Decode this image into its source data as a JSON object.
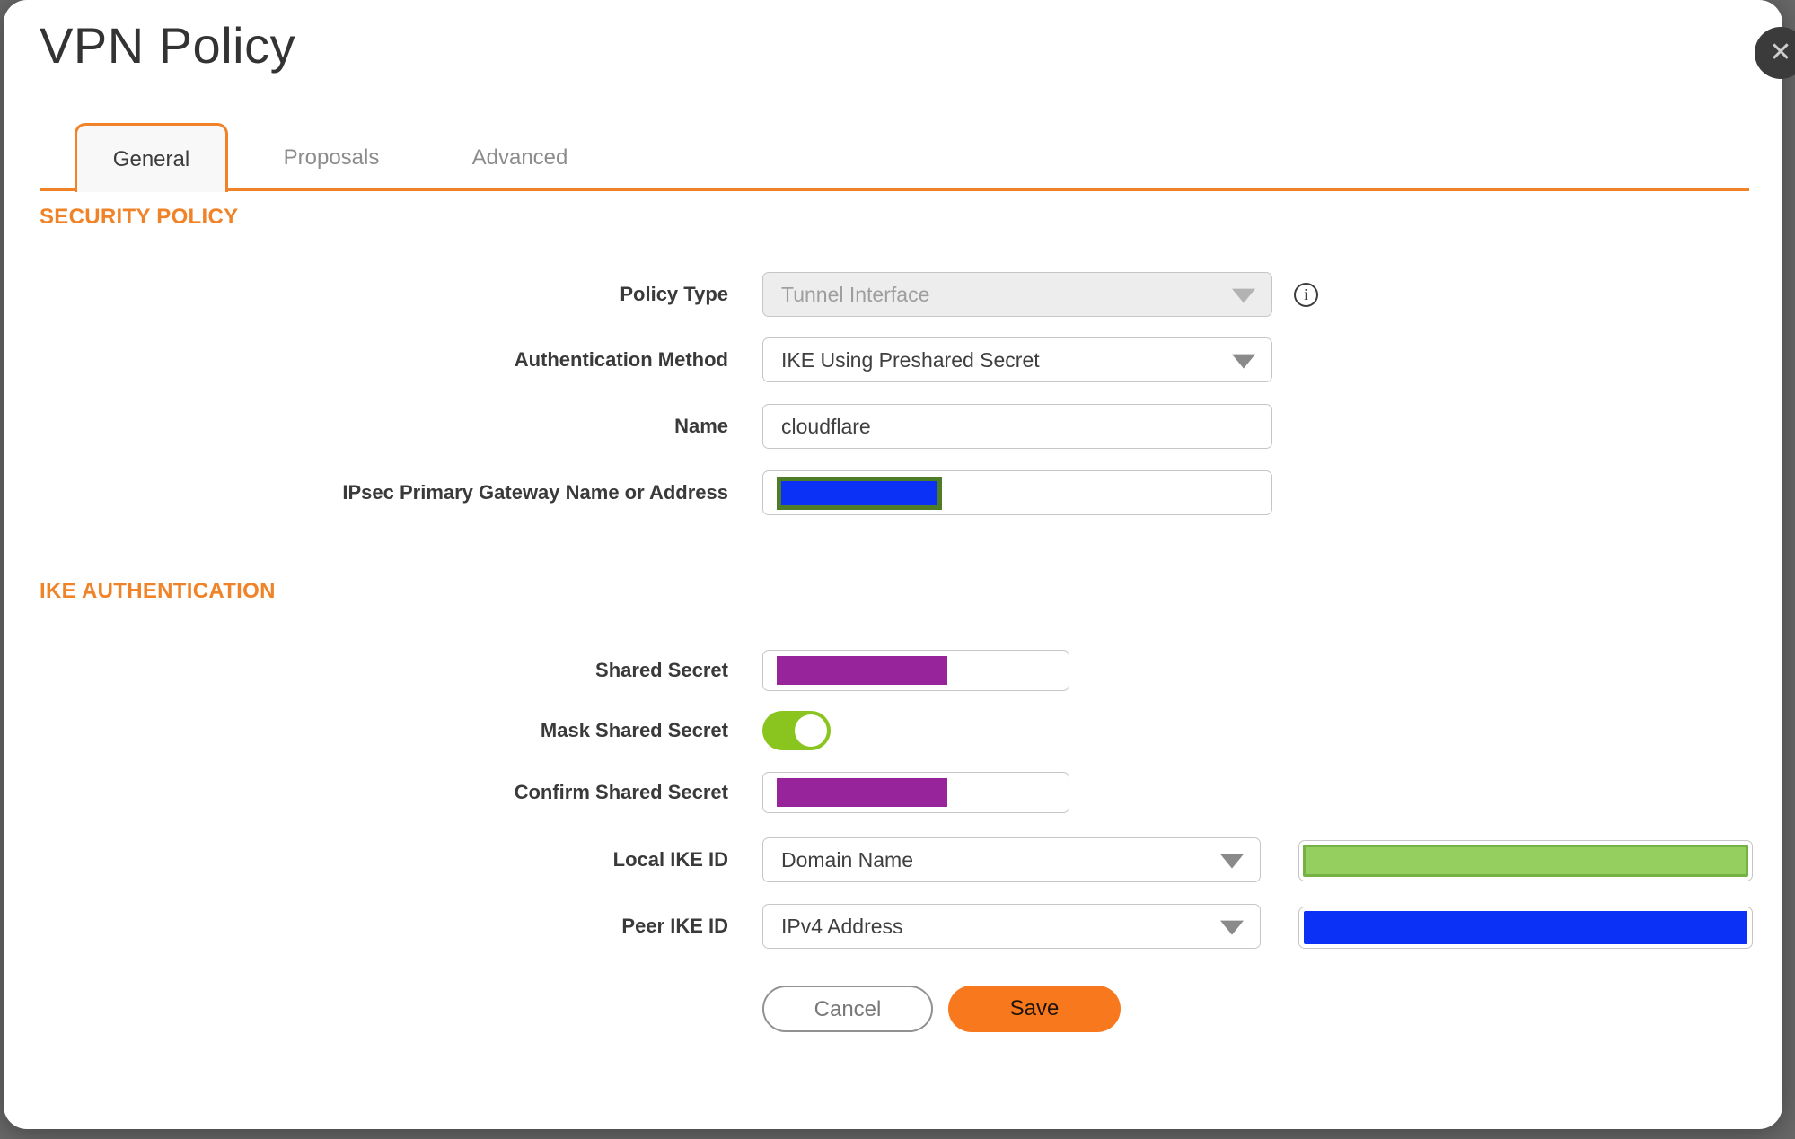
{
  "dialog": {
    "title": "VPN Policy"
  },
  "tabs": {
    "general": "General",
    "proposals": "Proposals",
    "advanced": "Advanced"
  },
  "sections": {
    "security_policy": "SECURITY POLICY",
    "ike_authentication": "IKE AUTHENTICATION"
  },
  "fields": {
    "policy_type": {
      "label": "Policy Type",
      "value": "Tunnel Interface",
      "disabled": true
    },
    "auth_method": {
      "label": "Authentication Method",
      "value": "IKE Using Preshared Secret"
    },
    "name": {
      "label": "Name",
      "value": "cloudflare"
    },
    "gateway": {
      "label": "IPsec Primary Gateway Name or Address",
      "value": ""
    },
    "shared_secret": {
      "label": "Shared Secret",
      "value": ""
    },
    "mask_shared_secret": {
      "label": "Mask Shared Secret",
      "state": "on"
    },
    "confirm_shared_secret": {
      "label": "Confirm Shared Secret",
      "value": ""
    },
    "local_ike_id": {
      "label": "Local IKE ID",
      "value": "Domain Name"
    },
    "peer_ike_id": {
      "label": "Peer IKE ID",
      "value": "IPv4 Address"
    }
  },
  "buttons": {
    "cancel": "Cancel",
    "save": "Save"
  },
  "icons": {
    "close": "✕",
    "info": "i"
  },
  "colors": {
    "accent": "#F08327",
    "tab-active-bg": "#F8F8F8",
    "backdrop": "#686868",
    "close-bg": "#3B3B3B",
    "redact-purple": "#98249C",
    "redact-blue": "#0A31F5",
    "redact-green": "#94CF60",
    "redact-green-border": "#76B243",
    "gateway-border": "#4F7D27",
    "toggle-green": "#8AC41F",
    "save-orange": "#F8791D"
  }
}
